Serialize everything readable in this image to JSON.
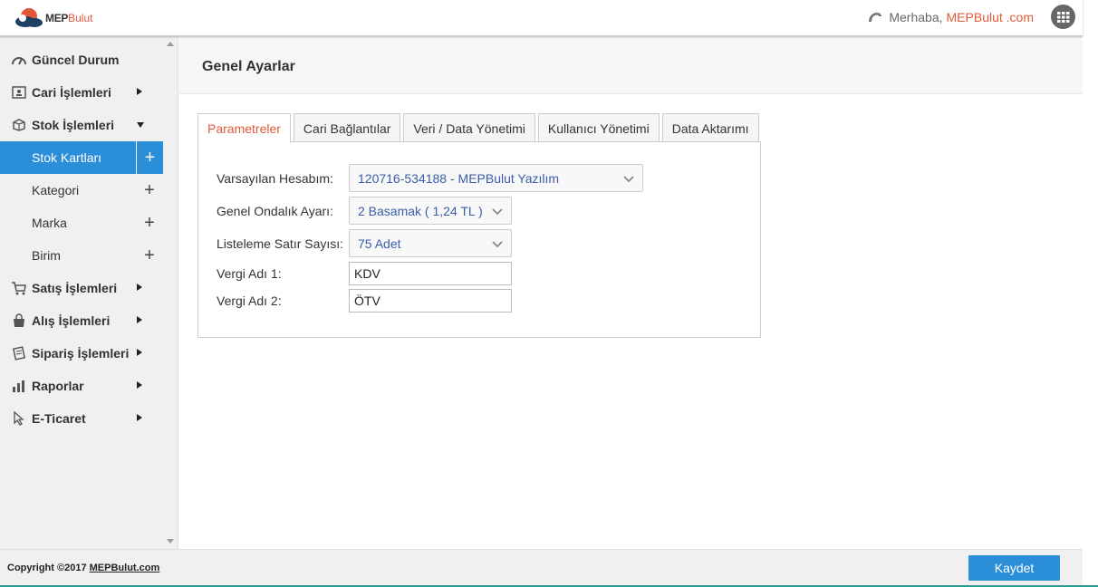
{
  "brand": {
    "name_part1": "MEP",
    "name_part2": "Bulut"
  },
  "header": {
    "greeting": "Merhaba,",
    "user": "MEPBulut .com"
  },
  "sidebar": {
    "items": [
      {
        "label": "Güncel Durum",
        "icon": "speedometer-icon"
      },
      {
        "label": "Cari İşlemleri",
        "icon": "contact-card-icon"
      },
      {
        "label": "Stok İşlemleri",
        "icon": "box-icon"
      },
      {
        "label": "Satış İşlemleri",
        "icon": "cart-icon"
      },
      {
        "label": "Alış İşlemleri",
        "icon": "shopping-bag-icon"
      },
      {
        "label": "Sipariş İşlemleri",
        "icon": "order-note-icon"
      },
      {
        "label": "Raporlar",
        "icon": "bar-chart-icon"
      },
      {
        "label": "E-Ticaret",
        "icon": "cursor-icon"
      }
    ],
    "stock_sub": [
      {
        "label": "Stok Kartları"
      },
      {
        "label": "Kategori"
      },
      {
        "label": "Marka"
      },
      {
        "label": "Birim"
      }
    ],
    "plus": "+"
  },
  "page": {
    "title": "Genel Ayarlar"
  },
  "tabs": [
    {
      "label": "Parametreler"
    },
    {
      "label": "Cari Bağlantılar"
    },
    {
      "label": "Veri / Data Yönetimi"
    },
    {
      "label": "Kullanıcı Yönetimi"
    },
    {
      "label": "Data Aktarımı"
    }
  ],
  "form": {
    "default_account": {
      "label": "Varsayılan Hesabım:",
      "value": "120716-534188 - MEPBulut Yazılım"
    },
    "decimal": {
      "label": "Genel Ondalık Ayarı:",
      "value": "2 Basamak ( 1,24 TL )"
    },
    "row_count": {
      "label": "Listeleme Satır Sayısı:",
      "value": "75 Adet"
    },
    "tax1": {
      "label": "Vergi Adı 1:",
      "value": "KDV"
    },
    "tax2": {
      "label": "Vergi Adı 2:",
      "value": "ÖTV"
    }
  },
  "footer": {
    "copyright": "Copyright ©2017",
    "link": "MEPBulut.com",
    "save": "Kaydet"
  },
  "colors": {
    "accent": "#2b8ed8",
    "brand_red": "#e05a3a",
    "link_blue": "#3a5da8"
  }
}
